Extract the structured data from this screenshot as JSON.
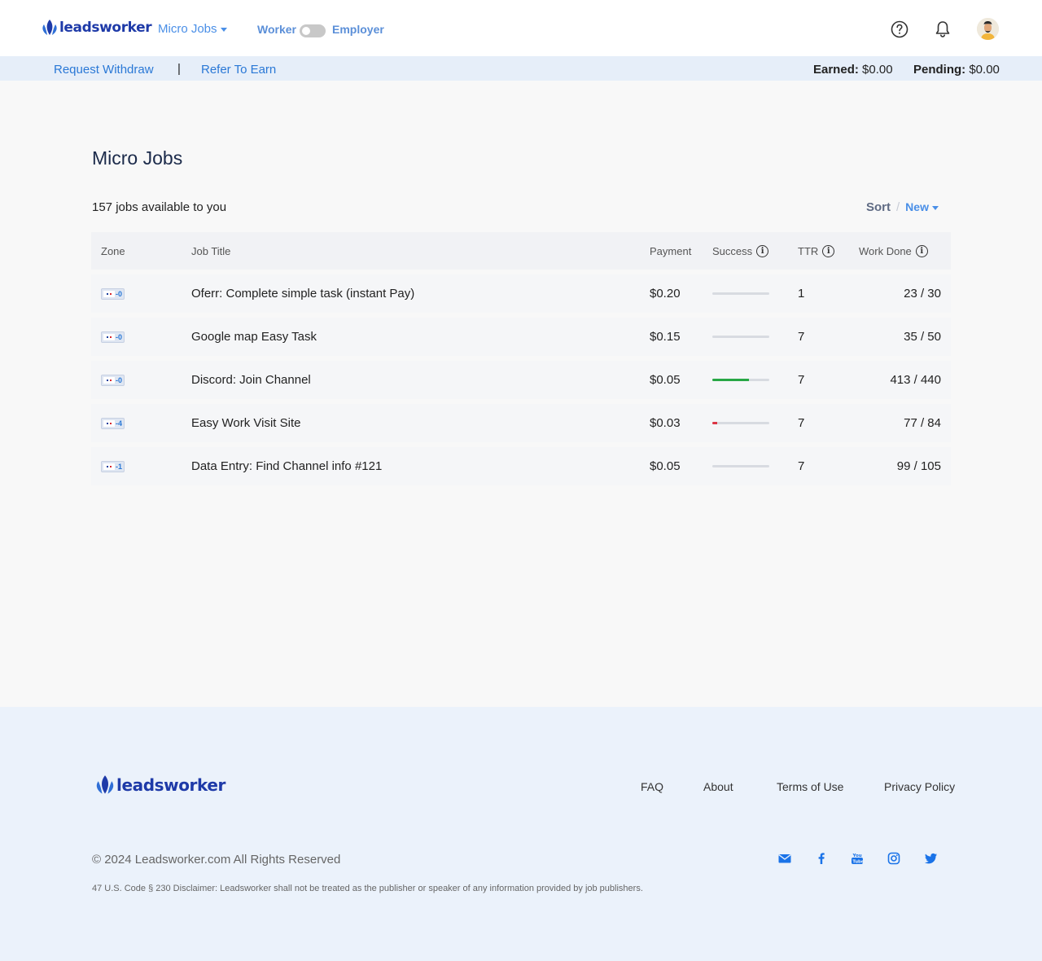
{
  "header": {
    "brand": "leadsworker",
    "nav_micro_jobs": "Micro Jobs",
    "role_worker": "Worker",
    "role_employer": "Employer",
    "role_toggle_icon": "toggle-switch-off",
    "help_icon": "question-circle-icon",
    "bell_icon": "bell-icon",
    "avatar_icon": "user-avatar"
  },
  "subbar": {
    "withdraw": "Request Withdraw",
    "separator": "|",
    "refer": "Refer To Earn",
    "earned_label": "Earned:",
    "earned_value": "$0.00",
    "pending_label": "Pending:",
    "pending_value": "$0.00"
  },
  "main": {
    "title": "Micro Jobs",
    "jobs_count": "157 jobs available to you",
    "sort_label": "Sort",
    "sort_separator": "/",
    "sort_value": "New"
  },
  "table": {
    "headers": {
      "zone": "Zone",
      "title": "Job Title",
      "payment": "Payment",
      "success": "Success",
      "ttr": "TTR",
      "work_done": "Work Done"
    },
    "rows": [
      {
        "zone": "-0",
        "title": "Oferr: Complete simple task (instant Pay)",
        "payment": "$0.20",
        "success": 0,
        "success_color": "#d8dbe1",
        "ttr": "1",
        "work_done": "23 / 30"
      },
      {
        "zone": "-0",
        "title": "Google map Easy Task",
        "payment": "$0.15",
        "success": 0,
        "success_color": "#d8dbe1",
        "ttr": "7",
        "work_done": "35 / 50"
      },
      {
        "zone": "-0",
        "title": "Discord: Join Channel",
        "payment": "$0.05",
        "success": 0.64,
        "success_color": "#28a745",
        "ttr": "7",
        "work_done": "413 / 440"
      },
      {
        "zone": "-4",
        "title": "Easy Work Visit Site",
        "payment": "$0.03",
        "success": 0.08,
        "success_color": "#dc3545",
        "ttr": "7",
        "work_done": "77 / 84"
      },
      {
        "zone": "-1",
        "title": "Data Entry: Find Channel info #121",
        "payment": "$0.05",
        "success": 0,
        "success_color": "#d8dbe1",
        "ttr": "7",
        "work_done": "99 / 105"
      }
    ]
  },
  "footer": {
    "brand": "leadsworker",
    "links": {
      "faq": "FAQ",
      "about": "About",
      "terms": "Terms of Use",
      "privacy": "Privacy Policy"
    },
    "copyright": "© 2024 Leadsworker.com All Rights Reserved",
    "disclaimer": "47 U.S. Code § 230 Disclaimer: Leadsworker shall not be treated as the publisher or speaker of any information provided by job publishers.",
    "social_icons": [
      "envelope-icon",
      "facebook-icon",
      "youtube-icon",
      "instagram-icon",
      "twitter-icon"
    ]
  },
  "colors": {
    "brand": "#1e3aa8",
    "link": "#2a78d6",
    "nav_accent": "#4a8fe7",
    "subbar_bg": "#e6eef9",
    "footer_bg": "#ebf2fb",
    "success_green": "#28a745",
    "success_red": "#dc3545"
  }
}
